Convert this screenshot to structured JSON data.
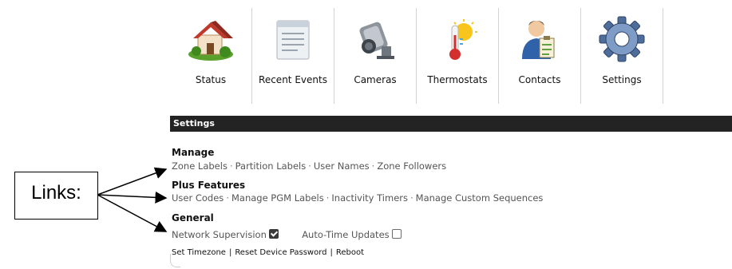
{
  "nav": {
    "items": [
      {
        "label": "Status",
        "icon": "house-icon"
      },
      {
        "label": "Recent Events",
        "icon": "document-icon"
      },
      {
        "label": "Cameras",
        "icon": "camera-icon"
      },
      {
        "label": "Thermostats",
        "icon": "thermostat-icon"
      },
      {
        "label": "Contacts",
        "icon": "contact-person-icon"
      },
      {
        "label": "Settings",
        "icon": "gear-icon"
      }
    ]
  },
  "panel": {
    "title": "Settings",
    "sections": {
      "manage": {
        "title": "Manage",
        "links": [
          "Zone Labels",
          "Partition Labels",
          "User Names",
          "Zone Followers"
        ]
      },
      "plus": {
        "title": "Plus Features",
        "links": [
          "User Codes",
          "Manage PGM Labels",
          "Inactivity Timers",
          "Manage Custom Sequences"
        ]
      },
      "general": {
        "title": "General",
        "network_label": "Network Supervision",
        "network_checked": true,
        "autotime_label": "Auto-Time Updates",
        "autotime_checked": false
      }
    },
    "bottom_links": [
      "Set Timezone",
      "Reset Device Password",
      "Reboot"
    ],
    "separator": "·",
    "pipe": "|"
  },
  "annotation": {
    "label": "Links:"
  },
  "colors": {
    "panel_header_bg": "#232323",
    "link_text": "#555555",
    "divider": "#d4d4d4"
  }
}
